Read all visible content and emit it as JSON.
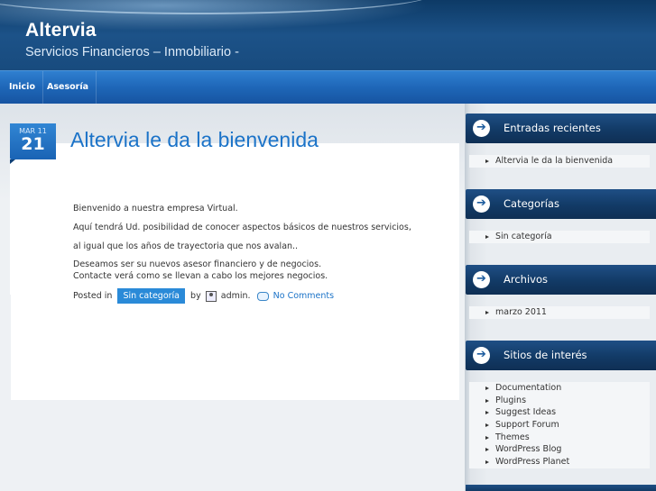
{
  "site": {
    "title": "Altervia",
    "description": "Servicios Financieros – Inmobiliario -"
  },
  "nav": {
    "items": [
      {
        "label": "Inicio"
      },
      {
        "label": "Asesoría"
      }
    ]
  },
  "post": {
    "month": "MAR 11",
    "day": "21",
    "title": "Altervia le da la bienvenida",
    "paragraphs": [
      "Bienvenido a nuestra empresa Virtual.",
      "Aquí tendrá Ud. posibilidad de conocer aspectos básicos de nuestros servicios,",
      "al igual que los años de trayectoria que nos avalan..",
      "Deseamos ser su nuevos asesor financiero y de negocios.",
      "Contacte verá como se llevan a cabo los mejores negocios."
    ],
    "meta": {
      "posted_in": "Posted in",
      "category": "Sin categoría",
      "by": "by",
      "author": "admin.",
      "comments": "No Comments"
    }
  },
  "sidebar": {
    "widgets": [
      {
        "title": "Entradas recientes",
        "items": [
          "Altervia le da la bienvenida"
        ]
      },
      {
        "title": "Categorías",
        "items": [
          "Sin categoría"
        ]
      },
      {
        "title": "Archivos",
        "items": [
          "marzo 2011"
        ]
      },
      {
        "title": "Sitios de interés",
        "items": [
          "Documentation",
          "Plugins",
          "Suggest Ideas",
          "Support Forum",
          "Themes",
          "WordPress Blog",
          "WordPress Planet"
        ]
      }
    ]
  },
  "colors": {
    "header": "#184b7e",
    "nav": "#1e66b7",
    "accent": "#1b73c8",
    "category_badge": "#2a8ad8",
    "widget_header": "#123a66"
  }
}
